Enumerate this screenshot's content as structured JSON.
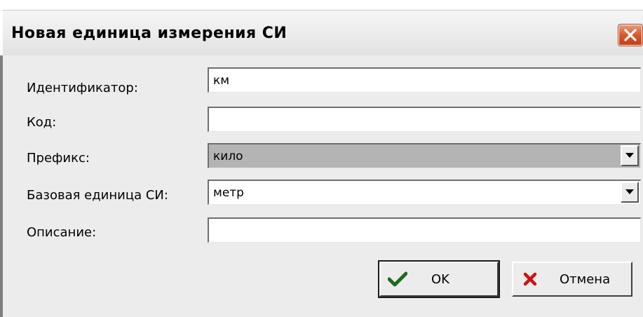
{
  "dialog": {
    "title": "Новая единица измерения СИ"
  },
  "form": {
    "identifier": {
      "label": "Идентификатор:",
      "value": "км"
    },
    "code": {
      "label": "Код:",
      "value": ""
    },
    "prefix": {
      "label": "Префикс:",
      "selected": "кило"
    },
    "base_unit": {
      "label": "Базовая единица СИ:",
      "selected": "метр"
    },
    "description": {
      "label": "Описание:",
      "value": ""
    }
  },
  "buttons": {
    "ok_label": "OK",
    "cancel_label": "Отмена"
  },
  "icons": {
    "close": "close-icon",
    "ok": "checkmark-icon",
    "cancel": "x-mark-icon",
    "dropdown": "chevron-down-icon"
  },
  "colors": {
    "close_button": "#d8582e",
    "ok_check": "#1e6b1e",
    "cancel_x": "#d01010",
    "disabled_field": "#b4b4b4"
  }
}
